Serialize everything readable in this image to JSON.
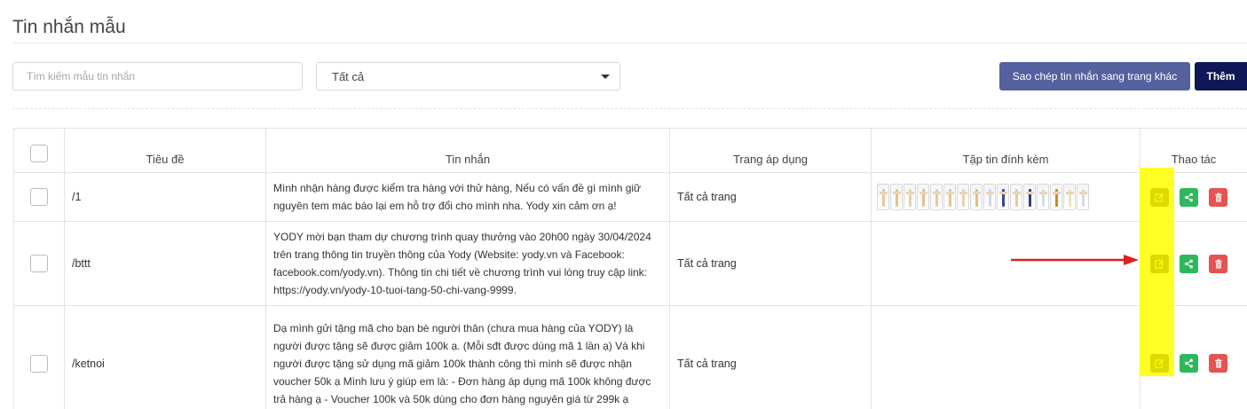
{
  "page": {
    "title": "Tin nhắn mẫu"
  },
  "toolbar": {
    "search_placeholder": "Tìm kiếm mẫu tin nhắn",
    "filter_selected": "Tất cả",
    "copy_label": "Sao chép tin nhắn sang trang khác",
    "add_label": "Thêm"
  },
  "colors": {
    "copy_button": "#55619e",
    "add_button": "#0f1757",
    "edit": "#111111",
    "share": "#2eb85c",
    "delete": "#e55353",
    "highlight": "#ffff00",
    "arrow": "#e02020"
  },
  "table": {
    "headers": {
      "title": "Tiêu đề",
      "message": "Tin nhắn",
      "page": "Trang áp dụng",
      "attachments": "Tập tin đính kèm",
      "actions": "Thao tác"
    },
    "rows": [
      {
        "title": "/1",
        "message": "Mình nhận hàng được kiểm tra hàng với thử hàng, Nếu có vấn đề gì mình giữ nguyên tem mác báo lại em hỗ trợ đổi cho mình nha. Yody xin cảm ơn ạ!",
        "page": "Tất cả trang",
        "attachment_count": 16
      },
      {
        "title": "/bttt",
        "message": "YODY mời bạn tham dự chương trình quay thưởng vào 20h00 ngày 30/04/2024 trên trang thông tin truyền thông của Yody (Website: yody.vn và Facebook: facebook.com/yody.vn). Thông tin chi tiết về chương trình vui lòng truy cập link: https://yody.vn/yody-10-tuoi-tang-50-chi-vang-9999.",
        "page": "Tất cả trang",
        "attachment_count": 0
      },
      {
        "title": "/ketnoi",
        "message": "Dạ mình gửi tặng mã cho bạn bè người thân (chưa mua hàng của YODY) là người được tặng sẽ được giảm 100k ạ. (Mỗi sđt được dùng mã 1 lần ạ) Và khi người được tặng sử dụng mã giảm 100k thành công thì mình sẽ được nhận voucher 50k ạ Mình lưu ý giúp em là: - Đơn hàng áp dụng mã 100k không được trả hàng ạ - Voucher 100k và 50k dùng cho đơn hàng nguyên giá từ 299k ạ",
        "page": "Tất cả trang",
        "attachment_count": 0
      }
    ]
  },
  "icons": {
    "edit": "edit-icon",
    "share": "share-icon",
    "delete": "trash-icon",
    "select": "chevron-down-icon"
  }
}
